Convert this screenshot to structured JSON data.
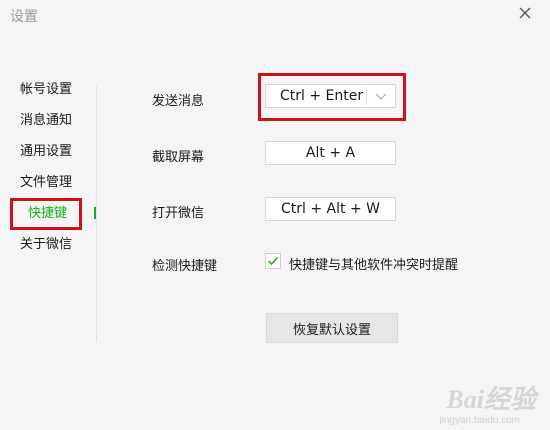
{
  "window": {
    "title": "设置"
  },
  "sidebar": {
    "items": [
      {
        "label": "帐号设置"
      },
      {
        "label": "消息通知"
      },
      {
        "label": "通用设置"
      },
      {
        "label": "文件管理"
      },
      {
        "label": "快捷键",
        "active": true
      },
      {
        "label": "关于微信"
      }
    ]
  },
  "shortcuts": {
    "send_message": {
      "label": "发送消息",
      "value": "Ctrl + Enter"
    },
    "screenshot": {
      "label": "截取屏幕",
      "value": "Alt + A"
    },
    "open_wechat": {
      "label": "打开微信",
      "value": "Ctrl + Alt + W"
    },
    "detect": {
      "label": "检测快捷键",
      "checkbox_label": "快捷键与其他软件冲突时提醒",
      "checked": true
    }
  },
  "reset_button": {
    "label": "恢复默认设置"
  },
  "watermark": {
    "text": "Bai经验",
    "sub": "jingyan.baidu.com"
  },
  "colors": {
    "accent": "#1aad19",
    "highlight": "#c8131b",
    "background": "#f5f5f5"
  }
}
